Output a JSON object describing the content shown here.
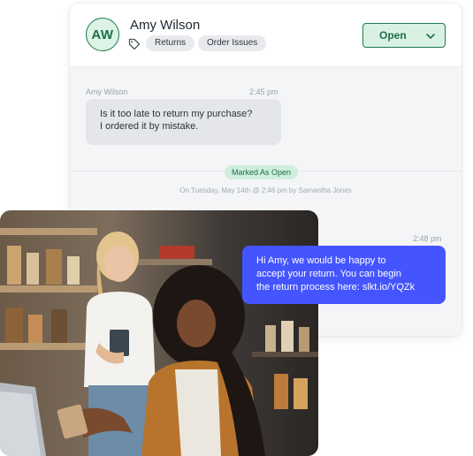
{
  "conversation": {
    "customer": {
      "initials": "AW",
      "name": "Amy Wilson"
    },
    "tags": [
      "Returns",
      "Order Issues"
    ],
    "status": "Open",
    "messages": [
      {
        "author": "Amy Wilson",
        "time": "2:45 pm",
        "lines": [
          "Is it too late to return my purchase?",
          "I ordered it by mistake."
        ]
      },
      {
        "time": "2:48 pm",
        "lines": [
          "Hi Amy, we would be happy to",
          "accept your return. You can begin",
          "the return process here: slkt.io/YQZk"
        ]
      }
    ],
    "event": {
      "label": "Marked As Open",
      "meta": "On Tuesday, May 14th @ 2:46 pm by Samantha Jones"
    }
  },
  "colors": {
    "accent_green": "#1e7a52",
    "status_bg": "#d9f1e3",
    "outgoing_bubble": "#4455ff",
    "incoming_bubble": "#e4e6ea"
  },
  "icons": {
    "tag": "tag-icon",
    "dropdown": "chevron-down-icon"
  }
}
